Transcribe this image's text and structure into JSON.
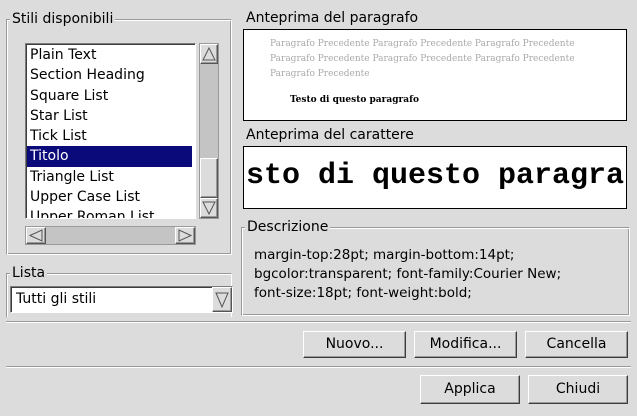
{
  "styles_group": {
    "title": "Stili disponibili",
    "items": [
      "Plain Text",
      "Section Heading",
      "Square List",
      "Star List",
      "Tick List",
      "Titolo",
      "Triangle List",
      "Upper Case List",
      "Upper Roman List"
    ],
    "selected_index": 5
  },
  "list_group": {
    "title": "Lista",
    "selected": "Tutti gli stili"
  },
  "paragraph_preview": {
    "title": "Anteprima del paragrafo",
    "preceding_lines": [
      "Paragrafo Precedente Paragrafo Precedente Paragrafo Precedente",
      "Paragrafo Precedente Paragrafo Precedente Paragrafo Precedente",
      "Paragrafo Precedente"
    ],
    "sample": "Testo di questo paragrafo"
  },
  "char_preview": {
    "title": "Anteprima del carattere",
    "sample": "sto di questo paragra"
  },
  "description": {
    "title": "Descrizione",
    "lines": [
      "margin-top:28pt; margin-bottom:14pt;",
      "bgcolor:transparent; font-family:Courier New;",
      "font-size:18pt; font-weight:bold;"
    ]
  },
  "buttons": {
    "new": "Nuovo...",
    "modify": "Modifica...",
    "delete": "Cancella",
    "apply": "Applica",
    "close": "Chiudi"
  },
  "colors": {
    "background": "#dcdcdc",
    "selection": "#0a0a7a"
  },
  "icons": {
    "scroll_up": "triangle-up",
    "scroll_down": "triangle-down",
    "scroll_left": "triangle-left",
    "scroll_right": "triangle-right",
    "combo_arrow": "triangle-down"
  }
}
